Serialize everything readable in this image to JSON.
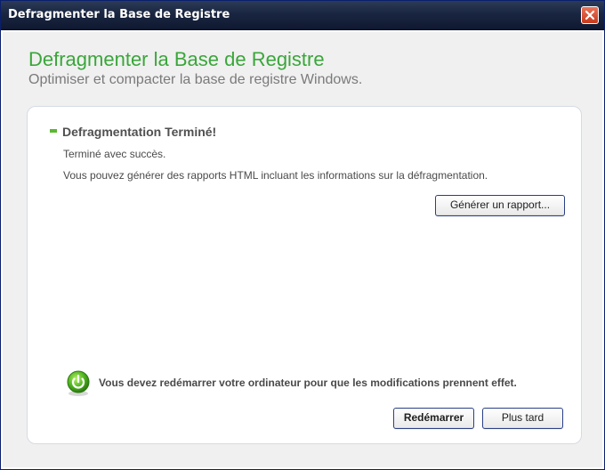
{
  "window": {
    "title": "Defragmenter la Base de Registre"
  },
  "header": {
    "title": "Defragmenter la Base de Registre",
    "subtitle": "Optimiser et compacter la base de registre Windows."
  },
  "panel": {
    "section_title": "Defragmentation Terminé!",
    "status_text": "Terminé avec succès.",
    "info_text": "Vous pouvez générer des rapports HTML incluant les informations sur la défragmentation.",
    "report_button": "Générer un rapport...",
    "restart_notice": "Vous devez redémarrer votre ordinateur pour que les modifications prennent effet.",
    "restart_button": "Redémarrer",
    "later_button": "Plus tard"
  },
  "icons": {
    "close": "close-icon",
    "restart": "power-icon"
  },
  "colors": {
    "accent_green": "#3aa63a",
    "titlebar": "#1a2641",
    "close_red": "#c9391c"
  }
}
